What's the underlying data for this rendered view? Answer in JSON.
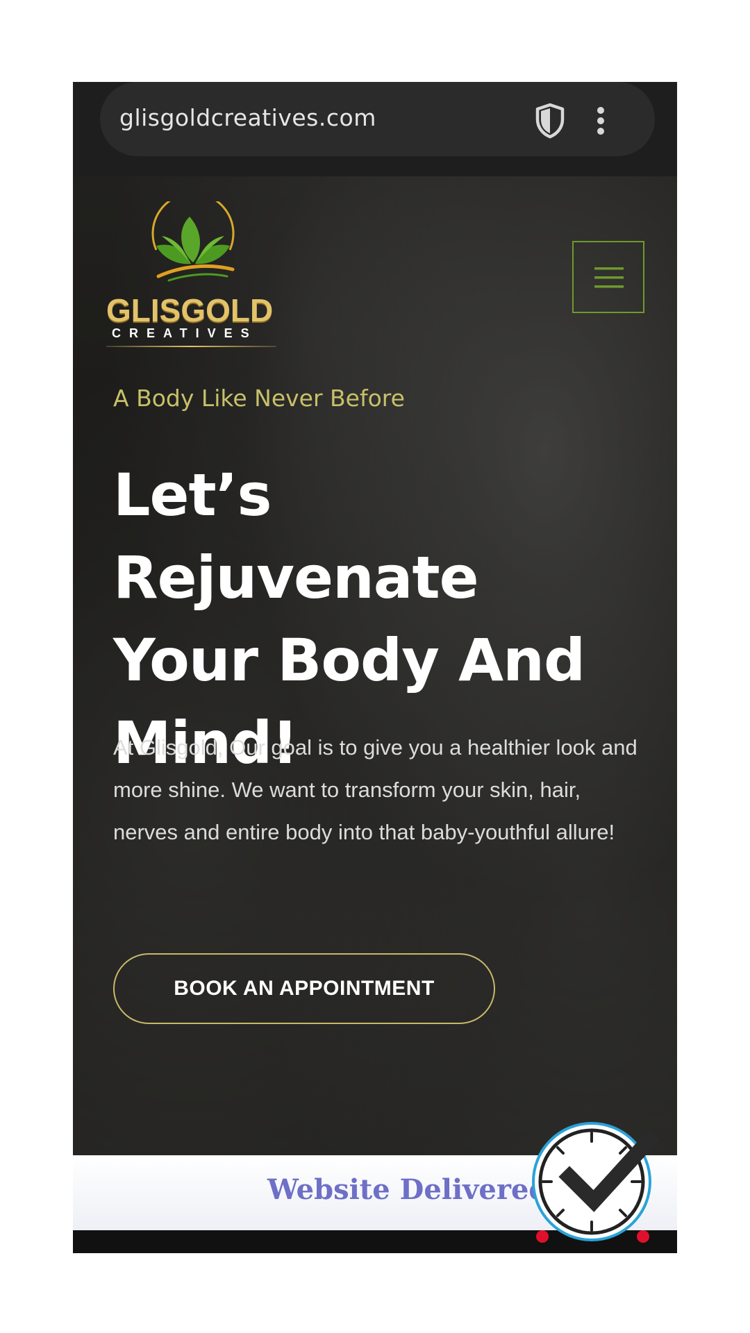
{
  "browser": {
    "url": "glisgoldcreatives.com",
    "shield_icon": "shield-icon",
    "menu_icon": "kebab-menu-icon"
  },
  "header": {
    "logo_text": "GLISGOLD",
    "logo_subtext": "CREATIVES",
    "menu_icon": "hamburger-icon"
  },
  "hero": {
    "tagline": "A Body Like Never Before",
    "headline_lines": [
      "Let’s Rejuvenate",
      "Your Body And",
      "Mind!"
    ],
    "intro": "At Glisgold, Our goal is to give you a healthier look and more shine. We want to transform your skin, hair, nerves and entire body into that baby-youthful allure!",
    "cta_label": "BOOK AN APPOINTMENT"
  },
  "banner": {
    "text": "Website Delivered",
    "badge_icon": "clock-check-icon"
  },
  "colors": {
    "accent_green": "#6f9a2c",
    "accent_gold": "#c8c06a",
    "banner_text": "#6e6fc6",
    "badge_ring": "#29a3d8"
  }
}
